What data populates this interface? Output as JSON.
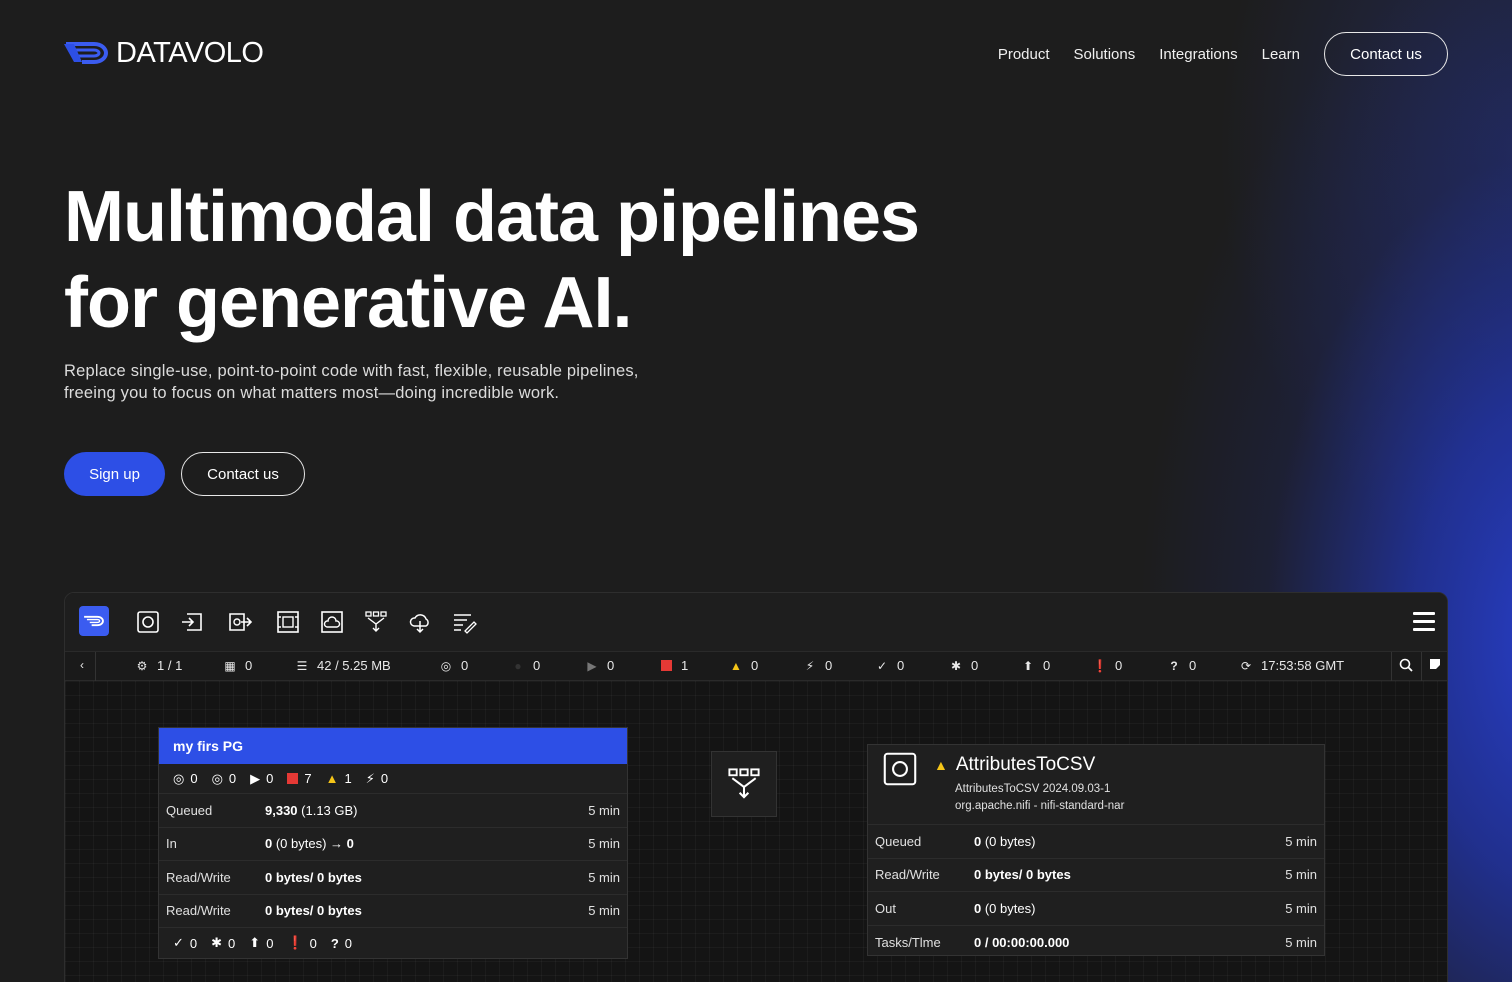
{
  "header": {
    "brand": "DATAVOLO",
    "nav": [
      "Product",
      "Solutions",
      "Integrations",
      "Learn"
    ],
    "contact_label": "Contact us"
  },
  "hero": {
    "title_line1": "Multimodal data pipelines",
    "title_line2": "for generative AI.",
    "subtitle_line1": "Replace single-use, point-to-point code with fast, flexible, reusable pipelines,",
    "subtitle_line2": "freeing you to focus on what matters most—doing incredible work.",
    "signup_label": "Sign up",
    "contact_label": "Contact us"
  },
  "app": {
    "toolbar_icons": [
      "processor-icon",
      "input-port-icon",
      "output-port-icon",
      "process-group-icon",
      "remote-process-group-icon",
      "funnel-icon",
      "template-icon",
      "label-icon"
    ],
    "status": {
      "threads": "1 / 1",
      "tasks": "0",
      "queued": "42 / 5.25 MB",
      "transmitting": "0",
      "not_transmitting": "0",
      "running": "0",
      "stopped": "1",
      "invalid": "0",
      "disabled": "0",
      "up_to_date": "0",
      "locally_modified": "0",
      "stale": "0",
      "locally_modified_stale": "0",
      "sync_failure": "0",
      "last_refresh": "17:53:58 GMT"
    },
    "process_group": {
      "name": "my firs PG",
      "counts": {
        "transmitting": "0",
        "not_transmitting": "0",
        "running": "0",
        "stopped": "7",
        "invalid": "1",
        "disabled": "0"
      },
      "rows": [
        {
          "label": "Queued",
          "value_bold": "9,330",
          "value_rest": " (1.13 GB)",
          "time": "5 min"
        },
        {
          "label": "In",
          "value_bold": "0",
          "value_rest": " (0 bytes) → ",
          "value_bold2": "0",
          "time": "5 min"
        },
        {
          "label": "Read/Write",
          "value_bold": "0 bytes/ 0 bytes",
          "value_rest": "",
          "time": "5 min"
        },
        {
          "label": "Read/Write",
          "value_bold": "0 bytes/ 0 bytes",
          "value_rest": "",
          "time": "5 min"
        }
      ],
      "footer": {
        "up_to_date": "0",
        "locally_modified": "0",
        "stale": "0",
        "locally_modified_stale": "0",
        "sync_failure": "0"
      }
    },
    "processor": {
      "name": "AttributesToCSV",
      "version": "AttributesToCSV 2024.09.03-1",
      "bundle": "org.apache.nifi - nifi-standard-nar",
      "rows": [
        {
          "label": "Queued",
          "value_bold": "0",
          "value_rest": " (0 bytes)",
          "time": "5 min"
        },
        {
          "label": "Read/Write",
          "value_bold": "0 bytes/ 0 bytes",
          "value_rest": "",
          "time": "5 min"
        },
        {
          "label": "Out",
          "value_bold": "0",
          "value_rest": " (0 bytes)",
          "time": "5 min"
        },
        {
          "label": "Tasks/Tlme",
          "value_bold": "0 / 00:00:00.000",
          "value_rest": "",
          "time": "5 min"
        }
      ]
    },
    "colors": {
      "accent": "#2d4fe6",
      "stopped": "#e53935",
      "warning": "#f5c518"
    }
  }
}
